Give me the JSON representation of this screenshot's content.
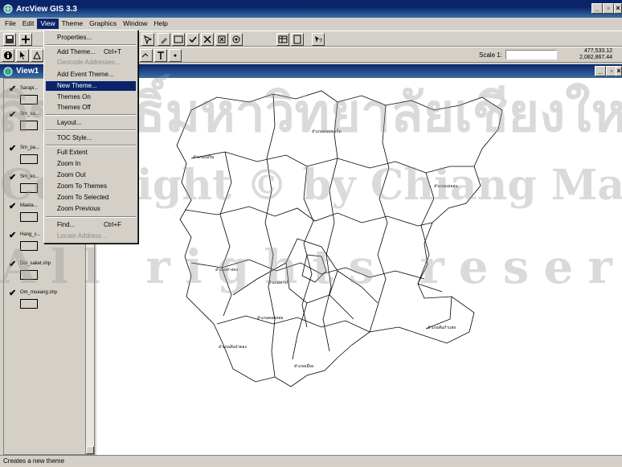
{
  "app": {
    "title": "ArcView GIS 3.3"
  },
  "menubar": {
    "items": [
      "File",
      "Edit",
      "View",
      "Theme",
      "Graphics",
      "Window",
      "Help"
    ],
    "active": "View"
  },
  "view": {
    "title": "View1",
    "scale_label": "Scale 1:",
    "coord_x": "477,533.12",
    "coord_y": "2,082,867.44"
  },
  "view_menu": {
    "properties": "Properties...",
    "add_theme": "Add Theme...",
    "add_theme_shortcut": "Ctrl+T",
    "geocode": "Geocode Addresses...",
    "add_event_theme": "Add Event Theme...",
    "new_theme": "New Theme...",
    "themes_on": "Themes On",
    "themes_off": "Themes Off",
    "layout": "Layout...",
    "toc_style": "TOC Style...",
    "full_extent": "Full Extent",
    "zoom_in": "Zoom In",
    "zoom_out": "Zoom Out",
    "zoom_to_themes": "Zoom To Themes",
    "zoom_to_selected": "Zoom To Selected",
    "zoom_previous": "Zoom Previous",
    "find": "Find...",
    "find_shortcut": "Ctrl+F",
    "locate_address": "Locate Address..."
  },
  "toc": {
    "themes": [
      "Sarapi...",
      "Sm_sa...",
      "Sm_pa...",
      "Sm_ko...",
      "Maeta...",
      "Hang_c...",
      "Doi_saket.shp",
      "Om_mueang.shp"
    ]
  },
  "map": {
    "labels": [
      "อำเภอดอยสะเก็ด",
      "อำเภอแม่ริม",
      "อำเภอแม่ออน",
      "อำเภอหางดง",
      "อำเภอสันกำแพง",
      "อำเภอสารภี",
      "อำเภอเมือง",
      "อำเภอสันป่าตอง",
      "อำเภอดอยหล่อ"
    ]
  },
  "watermark": {
    "line1": "ลิขสิทธิ์มหาวิทยาลัยเชียงใหม่",
    "line2": "Copyright © by Chiang Mai University",
    "line3": "All rights reserved"
  },
  "statusbar": {
    "text": "Creates a new theme"
  }
}
